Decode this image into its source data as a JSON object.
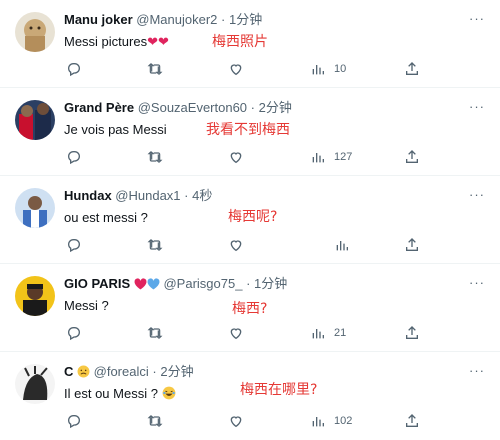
{
  "tweets": [
    {
      "name": "Manu joker",
      "handle": "@Manujoker2",
      "separator": "·",
      "time": "1分钟",
      "text": "Messi pictures",
      "text_emoji": "❤❤",
      "annotation": "梅西照片",
      "views": "10",
      "avatar_color": "#c9b49a"
    },
    {
      "name": "Grand Père",
      "handle": "@SouzaEverton60",
      "separator": "·",
      "time": "2分钟",
      "text": "Je vois pas Messi",
      "annotation": "我看不到梅西",
      "views": "127",
      "avatar_color": "#3a5a85"
    },
    {
      "name": "Hundax",
      "handle": "@Hundax1",
      "separator": "·",
      "time": "4秒",
      "text": "ou est messi ?",
      "annotation": "梅西呢?",
      "views": "",
      "avatar_color": "#4a7bc8"
    },
    {
      "name": "GIO PARIS",
      "name_badges": [
        "red-heart",
        "blue-heart"
      ],
      "handle": "@Parisgo75_",
      "separator": "·",
      "time": "1分钟",
      "text": "Messi ?",
      "annotation": "梅西?",
      "views": "21",
      "avatar_color": "#f2c319"
    },
    {
      "name": "C",
      "name_badges": [
        "sad-face"
      ],
      "handle": "@forealci",
      "separator": "·",
      "time": "2分钟",
      "text": "Il est ou Messi ?",
      "text_emoji": "😂",
      "annotation": "梅西在哪里?",
      "views": "102",
      "avatar_color": "#f0f0f0"
    }
  ],
  "icons": {
    "reply": "reply-icon",
    "retweet": "retweet-icon",
    "like": "heart-icon",
    "views": "views-icon",
    "share": "share-icon",
    "more": "more-icon"
  },
  "colors": {
    "annotation": "#e53935",
    "muted": "#536471",
    "heart_red": "#e0245e",
    "heart_blue": "#5ca8e8"
  }
}
